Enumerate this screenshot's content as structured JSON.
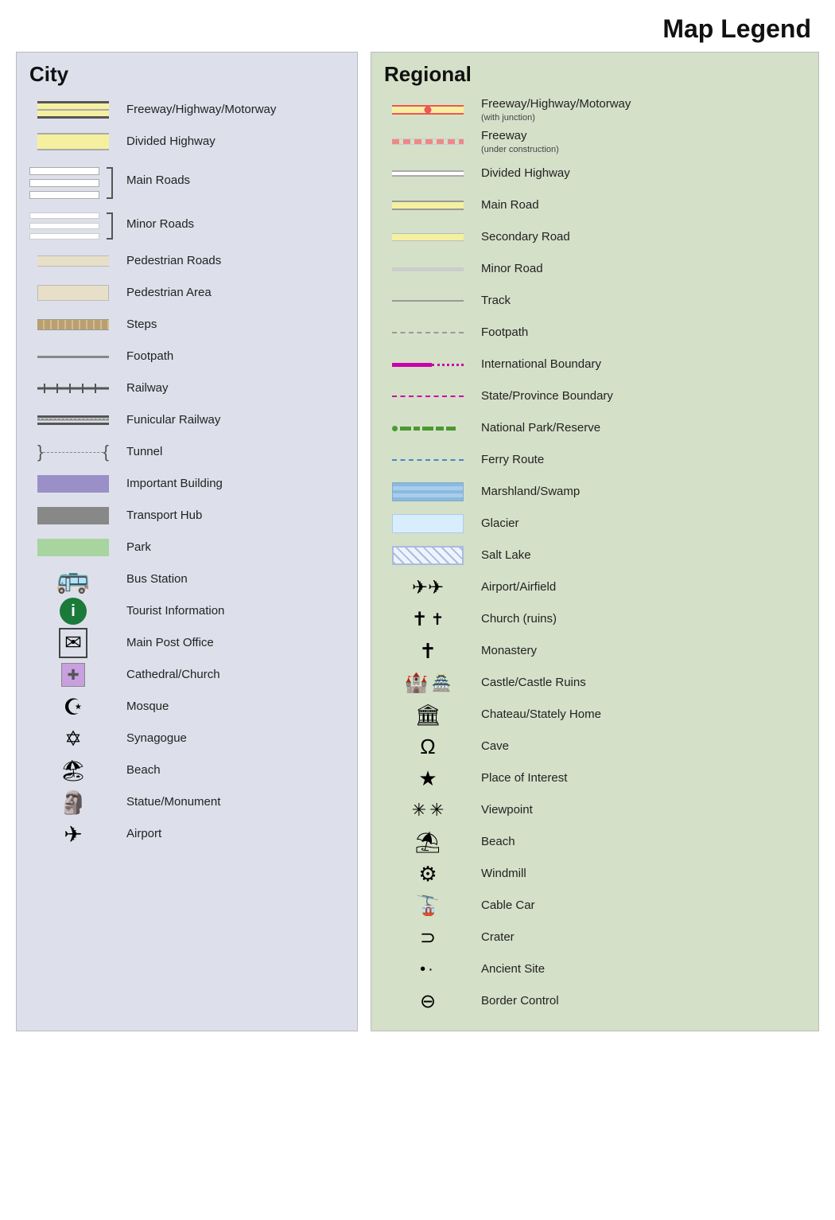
{
  "title": "Map Legend",
  "city": {
    "heading": "City",
    "items": [
      {
        "id": "freeway",
        "label": "Freeway/Highway/Motorway"
      },
      {
        "id": "divided-hwy",
        "label": "Divided Highway"
      },
      {
        "id": "main-roads",
        "label": "Main Roads"
      },
      {
        "id": "minor-roads",
        "label": "Minor Roads"
      },
      {
        "id": "pedestrian-roads",
        "label": "Pedestrian Roads"
      },
      {
        "id": "pedestrian-area",
        "label": "Pedestrian Area"
      },
      {
        "id": "steps",
        "label": "Steps"
      },
      {
        "id": "footpath",
        "label": "Footpath"
      },
      {
        "id": "railway",
        "label": "Railway"
      },
      {
        "id": "funicular",
        "label": "Funicular Railway"
      },
      {
        "id": "tunnel",
        "label": "Tunnel"
      },
      {
        "id": "important-building",
        "label": "Important Building"
      },
      {
        "id": "transport-hub",
        "label": "Transport Hub"
      },
      {
        "id": "park",
        "label": "Park"
      },
      {
        "id": "bus-station",
        "label": "Bus Station"
      },
      {
        "id": "tourist-info",
        "label": "Tourist Information"
      },
      {
        "id": "post-office",
        "label": "Main Post Office"
      },
      {
        "id": "cathedral",
        "label": "Cathedral/Church"
      },
      {
        "id": "mosque",
        "label": "Mosque"
      },
      {
        "id": "synagogue",
        "label": "Synagogue"
      },
      {
        "id": "beach",
        "label": "Beach"
      },
      {
        "id": "statue",
        "label": "Statue/Monument"
      },
      {
        "id": "airport",
        "label": "Airport"
      }
    ]
  },
  "regional": {
    "heading": "Regional",
    "items": [
      {
        "id": "reg-freeway",
        "label": "Freeway/Highway/Motorway",
        "sublabel": "(with junction)"
      },
      {
        "id": "reg-freeway-construction",
        "label": "Freeway",
        "sublabel": "(under construction)"
      },
      {
        "id": "reg-divided",
        "label": "Divided Highway"
      },
      {
        "id": "reg-main-road",
        "label": "Main Road"
      },
      {
        "id": "reg-secondary",
        "label": "Secondary Road"
      },
      {
        "id": "reg-minor",
        "label": "Minor Road"
      },
      {
        "id": "reg-track",
        "label": "Track"
      },
      {
        "id": "reg-footpath",
        "label": "Footpath"
      },
      {
        "id": "reg-intl-boundary",
        "label": "International Boundary"
      },
      {
        "id": "reg-state-boundary",
        "label": "State/Province Boundary"
      },
      {
        "id": "reg-natpark",
        "label": "National Park/Reserve"
      },
      {
        "id": "reg-ferry",
        "label": "Ferry Route"
      },
      {
        "id": "reg-marshland",
        "label": "Marshland/Swamp"
      },
      {
        "id": "reg-glacier",
        "label": "Glacier"
      },
      {
        "id": "reg-saltlake",
        "label": "Salt Lake"
      },
      {
        "id": "reg-airport",
        "label": "Airport/Airfield"
      },
      {
        "id": "reg-church",
        "label": "Church (ruins)"
      },
      {
        "id": "reg-monastery",
        "label": "Monastery"
      },
      {
        "id": "reg-castle",
        "label": "Castle/Castle Ruins"
      },
      {
        "id": "reg-chateau",
        "label": "Chateau/Stately Home"
      },
      {
        "id": "reg-cave",
        "label": "Cave"
      },
      {
        "id": "reg-interest",
        "label": "Place of Interest"
      },
      {
        "id": "reg-viewpoint",
        "label": "Viewpoint"
      },
      {
        "id": "reg-beach",
        "label": "Beach"
      },
      {
        "id": "reg-windmill",
        "label": "Windmill"
      },
      {
        "id": "reg-cablecar",
        "label": "Cable Car"
      },
      {
        "id": "reg-crater",
        "label": "Crater"
      },
      {
        "id": "reg-ancient",
        "label": "Ancient Site"
      },
      {
        "id": "reg-border",
        "label": "Border Control"
      }
    ]
  }
}
